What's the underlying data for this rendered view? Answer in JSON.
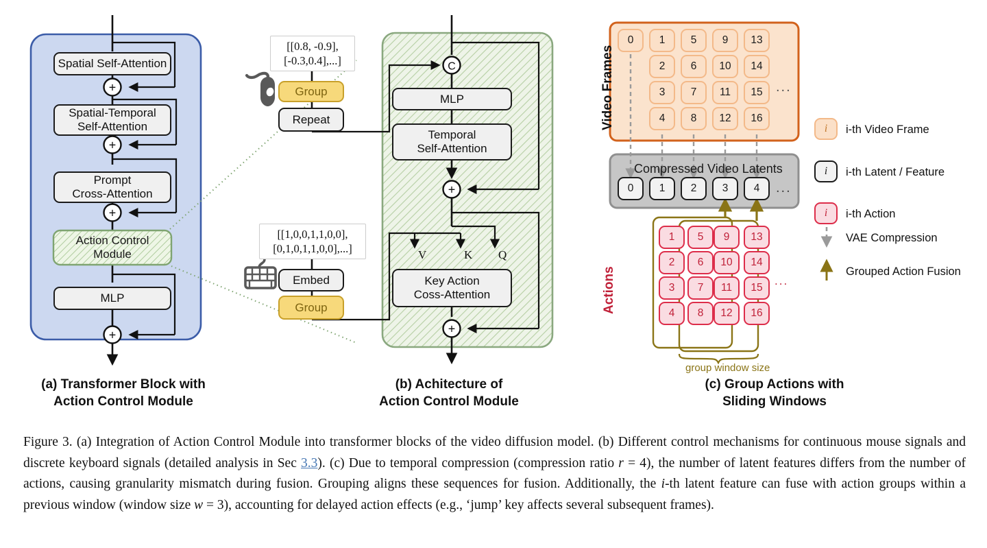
{
  "figure": {
    "number": "Figure 3.",
    "caption_parts": [
      "(a) Integration of Action Control Module into transformer blocks of the video diffusion model. (b) Different control mechanisms for continuous mouse signals and discrete keyboard signals (detailed analysis in Sec ",
      "3.3",
      "). (c) Due to temporal compression (compression ratio ",
      "r",
      " = 4), the number of latent features differs from the number of actions, causing granularity mismatch during fusion. Grouping aligns these sequences for fusion. Additionally, the ",
      "i",
      "-th latent feature can fuse with action groups within a previous window (window size ",
      "w",
      " = 3), accounting for delayed action effects (e.g., ‘jump’ key affects several subsequent frames)."
    ],
    "link_color": "#4878b4"
  },
  "panel_a": {
    "caption_line1": "(a) Transformer Block with",
    "caption_line2": "Action Control Module",
    "panel_fill": "#ccd8f0",
    "panel_stroke": "#3b5ca8",
    "blocks": [
      {
        "id": "spatial-self-attention",
        "lines": [
          "Spatial Self-Attention"
        ]
      },
      {
        "id": "spatial-temporal-self-attention",
        "lines": [
          "Spatial-Temporal",
          "Self-Attention"
        ]
      },
      {
        "id": "prompt-cross-attention",
        "lines": [
          "Prompt",
          "Cross-Attention"
        ]
      },
      {
        "id": "action-control-module",
        "lines": [
          "Action Control",
          "Module"
        ],
        "highlight": true
      },
      {
        "id": "mlp",
        "lines": [
          "MLP"
        ]
      }
    ],
    "adders": [
      "+",
      "+",
      "+",
      "+"
    ]
  },
  "panel_b": {
    "caption_line1": "(b) Achitecture of",
    "caption_line2": "Action Control Module",
    "panel_fill": "#eaf1e2",
    "panel_stroke": "#8aa87f",
    "mouse": {
      "icon": "mouse-icon",
      "matrix_line1": "[[0.8, -0.9],",
      "matrix_line2": "[-0.3,0.4],...]",
      "ops": [
        {
          "id": "group-mouse",
          "label": "Group",
          "style": "yellow"
        },
        {
          "id": "repeat",
          "label": "Repeat",
          "style": "grey"
        }
      ]
    },
    "keyboard": {
      "icon": "keyboard-icon",
      "matrix_line1": "[[1,0,0,1,1,0,0],",
      "matrix_line2": "[0,1,0,1,1,0,0],...]",
      "ops": [
        {
          "id": "embed",
          "label": "Embed",
          "style": "grey"
        },
        {
          "id": "group-keyboard",
          "label": "Group",
          "style": "yellow"
        }
      ]
    },
    "concat_symbol": "C",
    "blocks": [
      {
        "id": "mlp-b",
        "lines": [
          "MLP"
        ]
      },
      {
        "id": "temporal-self-attention",
        "lines": [
          "Temporal",
          "Self-Attention"
        ]
      },
      {
        "id": "key-action-cross-attention",
        "lines": [
          "Key Action",
          "Coss-Attention"
        ]
      }
    ],
    "qkv_labels": [
      "V",
      "K",
      "Q"
    ],
    "adders": [
      "+",
      "+"
    ]
  },
  "panel_c": {
    "caption_line1": "(c) Group Actions with",
    "caption_line2": "Sliding Windows",
    "video_frames": {
      "label": "Video Frames",
      "fill": "#fbe3cd",
      "stroke": "#d2621c",
      "columns": [
        [
          "0"
        ],
        [
          "1",
          "2",
          "3",
          "4"
        ],
        [
          "5",
          "6",
          "7",
          "8"
        ],
        [
          "9",
          "10",
          "11",
          "12"
        ],
        [
          "13",
          "14",
          "15",
          "16"
        ]
      ],
      "ellipsis": "..."
    },
    "latents": {
      "title": "Compressed Video Latents",
      "fill": "#c6c6c6",
      "stroke": "#8f8f8f",
      "items": [
        "0",
        "1",
        "2",
        "3",
        "4"
      ],
      "ellipsis": "..."
    },
    "actions": {
      "label": "Actions",
      "label_color": "#c02038",
      "columns": [
        [
          "1",
          "2",
          "3",
          "4"
        ],
        [
          "5",
          "6",
          "7",
          "8"
        ],
        [
          "9",
          "10",
          "11",
          "12"
        ],
        [
          "13",
          "14",
          "15",
          "16"
        ]
      ],
      "ellipsis": "...",
      "group_window_label": "group window size",
      "group_color": "#8a7416"
    }
  },
  "legend": {
    "items": [
      {
        "id": "legend-video-frame",
        "swatch": "frame",
        "symbol": "i",
        "label": "i-th Video Frame"
      },
      {
        "id": "legend-latent",
        "swatch": "latent",
        "symbol": "i",
        "label": "i-th Latent / Feature"
      },
      {
        "id": "legend-action",
        "swatch": "action",
        "symbol": "i",
        "label": "i-th Action"
      },
      {
        "id": "legend-vae",
        "swatch": "dashed-arrow",
        "label": "VAE Compression"
      },
      {
        "id": "legend-fusion",
        "swatch": "solid-arrow",
        "label": "Grouped Action Fusion"
      }
    ]
  },
  "colors": {
    "orange_border": "#d2621c",
    "orange_fill": "#fbe3cd",
    "red": "#dd2d4a",
    "olive": "#8a7416",
    "grey_arrow": "#9a9a9a",
    "blue_panel": "#ccd8f0",
    "green_panel": "#eaf1e2"
  }
}
